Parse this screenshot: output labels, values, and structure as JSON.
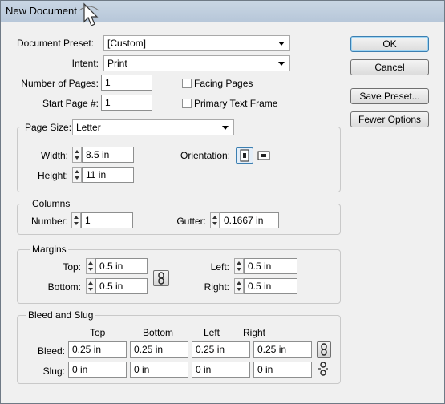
{
  "window": {
    "title": "New Document"
  },
  "top": {
    "preset_label": "Document Preset:",
    "preset_value": "[Custom]",
    "intent_label": "Intent:",
    "intent_value": "Print",
    "pages_label": "Number of Pages:",
    "pages_value": "1",
    "start_label": "Start Page #:",
    "start_value": "1",
    "facing_label": "Facing Pages",
    "primary_label": "Primary Text Frame"
  },
  "page_size": {
    "label": "Page Size:",
    "value": "Letter",
    "width_label": "Width:",
    "width_value": "8.5 in",
    "height_label": "Height:",
    "height_value": "11 in",
    "orientation_label": "Orientation:"
  },
  "columns": {
    "title": "Columns",
    "number_label": "Number:",
    "number_value": "1",
    "gutter_label": "Gutter:",
    "gutter_value": "0.1667 in"
  },
  "margins": {
    "title": "Margins",
    "top_label": "Top:",
    "top_value": "0.5 in",
    "bottom_label": "Bottom:",
    "bottom_value": "0.5 in",
    "left_label": "Left:",
    "left_value": "0.5 in",
    "right_label": "Right:",
    "right_value": "0.5 in"
  },
  "bleed": {
    "title": "Bleed and Slug",
    "headers": [
      "Top",
      "Bottom",
      "Left",
      "Right"
    ],
    "bleed_label": "Bleed:",
    "bleed_values": [
      "0.25 in",
      "0.25 in",
      "0.25 in",
      "0.25 in"
    ],
    "slug_label": "Slug:",
    "slug_values": [
      "0 in",
      "0 in",
      "0 in",
      "0 in"
    ]
  },
  "buttons": {
    "ok": "OK",
    "cancel": "Cancel",
    "save_preset": "Save Preset...",
    "fewer_options": "Fewer Options"
  },
  "icons": {
    "cursor": "pointer-cursor-icon",
    "portrait": "portrait-orientation-icon",
    "landscape": "landscape-orientation-icon",
    "link": "chain-link-icon",
    "unlink": "broken-chain-icon"
  }
}
